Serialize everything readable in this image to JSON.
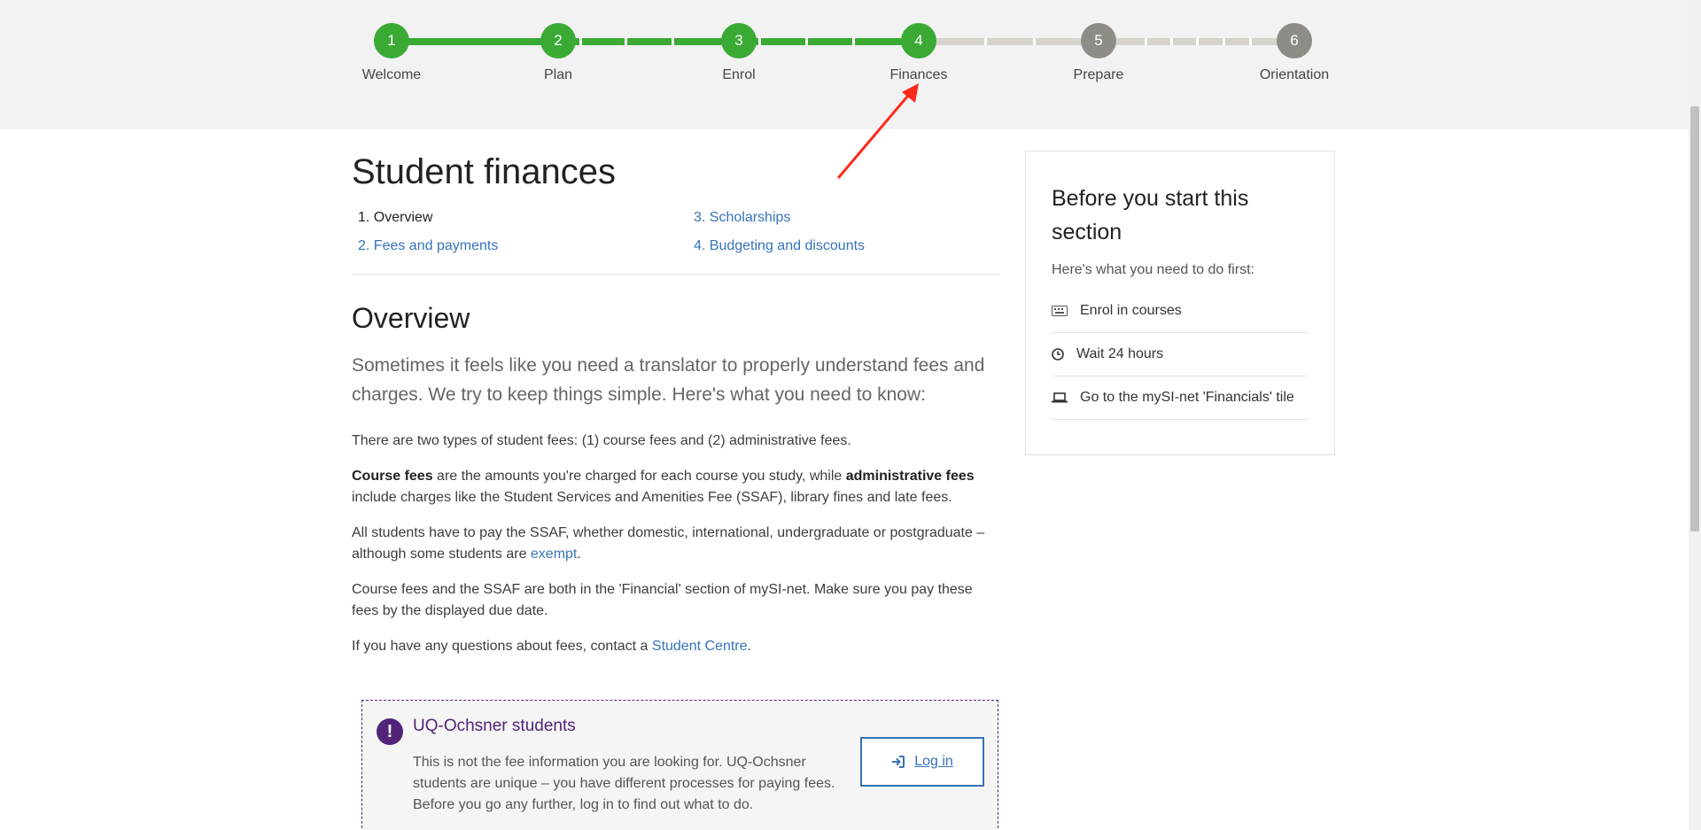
{
  "progress": {
    "steps": [
      {
        "number": "1",
        "label": "Welcome",
        "state": "complete"
      },
      {
        "number": "2",
        "label": "Plan",
        "state": "complete"
      },
      {
        "number": "3",
        "label": "Enrol",
        "state": "complete"
      },
      {
        "number": "4",
        "label": "Finances",
        "state": "current"
      },
      {
        "number": "5",
        "label": "Prepare",
        "state": "upcoming"
      },
      {
        "number": "6",
        "label": "Orientation",
        "state": "upcoming"
      }
    ],
    "colors": {
      "complete": "#3aaa35",
      "upcoming": "#8f8b87",
      "track_upcoming": "#d6d2cd"
    }
  },
  "annotation": {
    "icon": "red-arrow-icon",
    "color": "#ff2a1a"
  },
  "main": {
    "title": "Student finances",
    "toc": [
      {
        "label": "1. Overview",
        "current": true
      },
      {
        "label": "2. Fees and payments",
        "current": false
      },
      {
        "label": "3. Scholarships",
        "current": false
      },
      {
        "label": "4. Budgeting and discounts",
        "current": false
      }
    ],
    "section_title": "Overview",
    "lead": "Sometimes it feels like you need a translator to properly understand fees and charges. We try to keep things simple. Here's what you need to know:",
    "p1": "There are two types of student fees: (1) course fees and (2) administrative fees.",
    "p2": {
      "bold1": "Course fees",
      "text1": " are the amounts you're charged for each course you study, while ",
      "bold2": "administrative fees",
      "text2": " include charges like the Student Services and Amenities Fee (SSAF), library fines and late fees."
    },
    "p3": {
      "text": "All students have to pay the SSAF, whether domestic, international, undergraduate or postgraduate – although some students are ",
      "link": "exempt",
      "end": "."
    },
    "p4": "Course fees and the SSAF are both in the 'Financial' section of mySI-net. Make sure you pay these fees by the displayed due date.",
    "p5": {
      "text": "If you have any questions about fees, contact a ",
      "link": "Student Centre",
      "end": "."
    }
  },
  "callout": {
    "icon": "exclamation-icon",
    "title": "UQ-Ochsner students",
    "body": "This is not the fee information you are looking for. UQ-Ochsner students are unique – you have different processes for paying fees. Before you go any further, log in to find out what to do.",
    "button_label": "Log in",
    "button_icon": "sign-in-icon",
    "accent": "#51247a"
  },
  "sidebar": {
    "title": "Before you start this section",
    "subtitle": "Here's what you need to do first:",
    "items": [
      {
        "icon": "keyboard-icon",
        "label": "Enrol in courses"
      },
      {
        "icon": "clock-icon",
        "label": "Wait 24 hours"
      },
      {
        "icon": "laptop-icon",
        "label": "Go to the mySI-net 'Financials' tile"
      }
    ]
  },
  "link_color": "#3873b8"
}
